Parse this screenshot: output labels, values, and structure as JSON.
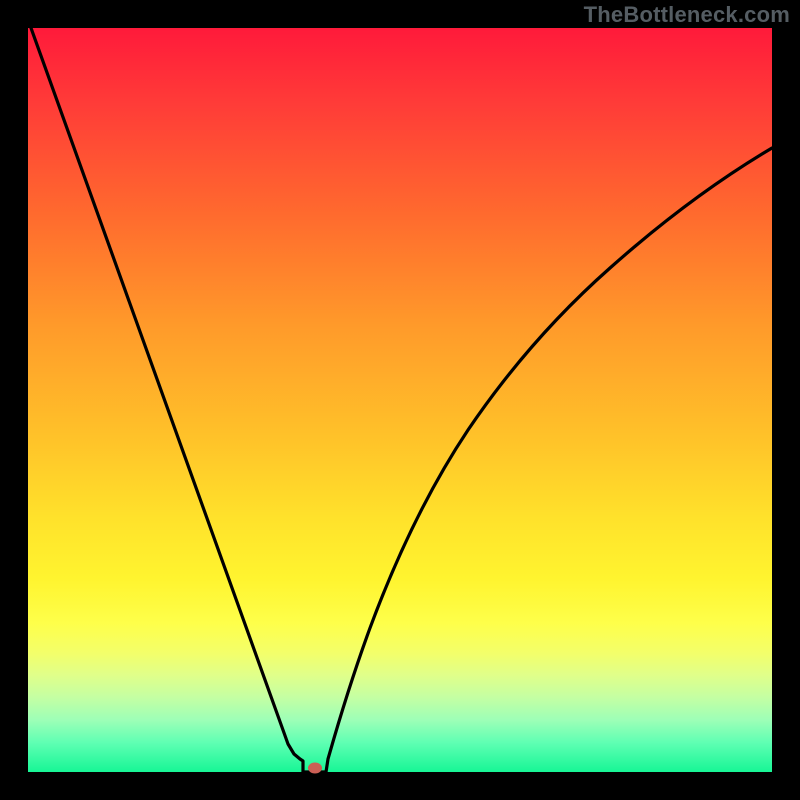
{
  "watermark": "TheBottleneck.com",
  "colors": {
    "frame": "#000000",
    "curve": "#000000",
    "dot": "#cb5f55"
  },
  "chart_data": {
    "type": "line",
    "title": "",
    "xlabel": "",
    "ylabel": "",
    "xlim": [
      0,
      100
    ],
    "ylim": [
      0,
      100
    ],
    "grid": false,
    "legend": false,
    "curve_left": {
      "name": "left-branch",
      "x": [
        0,
        5,
        10,
        15,
        20,
        25,
        30,
        33,
        35,
        36
      ],
      "y": [
        100,
        86,
        72,
        58,
        44,
        30,
        16,
        6,
        1,
        0
      ]
    },
    "curve_right": {
      "name": "right-branch",
      "x": [
        38,
        40,
        43,
        46,
        50,
        55,
        60,
        65,
        70,
        75,
        80,
        85,
        90,
        95,
        100
      ],
      "y": [
        0,
        8,
        20,
        30,
        40,
        49,
        56,
        62,
        67,
        71,
        74,
        77,
        80,
        82,
        84
      ]
    },
    "optimum_marker": {
      "x": 37,
      "y": 0
    },
    "background_gradient": "vertical red→yellow→green (bottleneck severity)"
  }
}
